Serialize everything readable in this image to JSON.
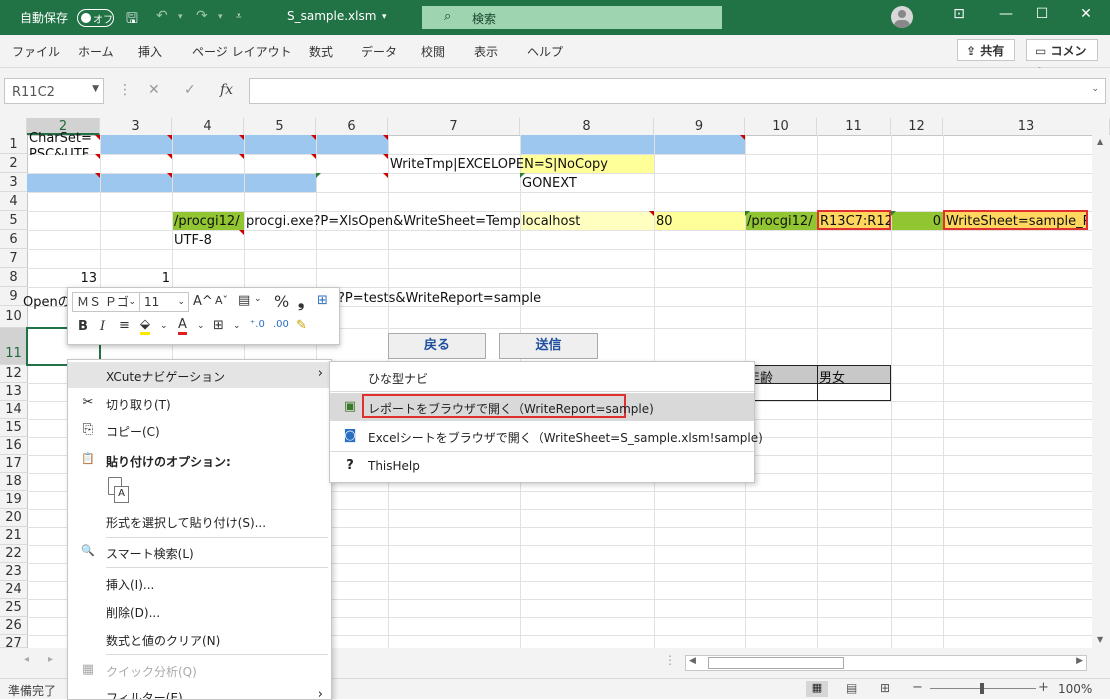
{
  "titlebar": {
    "autosave_label": "自動保存",
    "autosave_state": "オフ",
    "filename": "S_sample.xlsm",
    "search_placeholder": "検索",
    "bg_color": "#217346"
  },
  "ribbon": {
    "tabs": [
      "ファイル",
      "ホーム",
      "挿入",
      "ページ レイアウト",
      "数式",
      "データ",
      "校閲",
      "表示",
      "ヘルプ"
    ],
    "share_label": "共有",
    "comment_label": "コメント"
  },
  "formula_bar": {
    "name_box": "R11C2",
    "fx_label": "fx",
    "content": ""
  },
  "grid": {
    "column_headers": [
      "2",
      "3",
      "4",
      "5",
      "6",
      "7",
      "8",
      "9",
      "10",
      "11",
      "12",
      "13"
    ],
    "selected_column": "2",
    "row_headers": [
      "1",
      "2",
      "3",
      "4",
      "5",
      "6",
      "7",
      "8",
      "9",
      "10",
      "11",
      "12",
      "13",
      "14",
      "15",
      "16",
      "17",
      "18",
      "19",
      "20",
      "21",
      "22",
      "23",
      "24",
      "25",
      "26",
      "27"
    ],
    "selected_row": "11",
    "cells": {
      "r1c2": "CharSet=",
      "r2c2": "PSC&UTF",
      "r2c7": "WriteTmp|EXCELOPEN=S|NoCopy",
      "r3c8": "GONEXT",
      "r5c4": "/procgi12/",
      "r5c5": "procgi.exe?P=XlsOpen&WriteSheet=Templat",
      "r5c8": "localhost",
      "r5c9": "80",
      "r5c10": "/procgi12/",
      "r5c11": "R13C7:R12",
      "r5c12": "0",
      "r5c13": "WriteSheet=sample_R",
      "r6c4": "UTF-8",
      "r8c2": "13",
      "r8c3": "1",
      "r9c2": "Openの",
      "r9c6": "?P=tests&WriteReport=sample",
      "r12c10": "年齢",
      "r12c11": "男女"
    },
    "buttons": {
      "back": "戻る",
      "send": "送信"
    }
  },
  "mini_toolbar": {
    "font_name": "ＭＳ Ｐゴ",
    "font_size": "11",
    "bold": "B",
    "italic": "I",
    "percent": "%",
    "comma": "❟",
    "font_color_glyph": "A",
    "grow_font": "A^",
    "shrink_font": "Aˇ"
  },
  "context_menu": {
    "items": [
      {
        "label": "XCuteナビゲーション",
        "icon": "",
        "arrow": "›"
      },
      {
        "label": "切り取り(T)",
        "icon": "✂"
      },
      {
        "label": "コピー(C)",
        "icon": "⎘"
      },
      {
        "label": "貼り付けのオプション:",
        "icon": "📋"
      },
      {
        "label": "形式を選択して貼り付け(S)...",
        "icon": ""
      },
      {
        "label": "スマート検索(L)",
        "icon": "🔍"
      },
      {
        "label": "挿入(I)...",
        "icon": ""
      },
      {
        "label": "削除(D)...",
        "icon": ""
      },
      {
        "label": "数式と値のクリア(N)",
        "icon": ""
      },
      {
        "label": "クイック分析(Q)",
        "icon": "▦"
      },
      {
        "label": "フィルター(E)",
        "icon": "",
        "arrow": "›"
      }
    ]
  },
  "submenu": {
    "items": [
      {
        "label": "ひな型ナビ"
      },
      {
        "label": "レポートをブラウザで開く（WriteReport=sample)"
      },
      {
        "label": "Excelシートをブラウザで開く（WriteSheet=S_sample.xlsm!sample)"
      },
      {
        "label": "ThisHelp"
      }
    ]
  },
  "status": {
    "ready": "準備完了",
    "zoom": "100%"
  }
}
